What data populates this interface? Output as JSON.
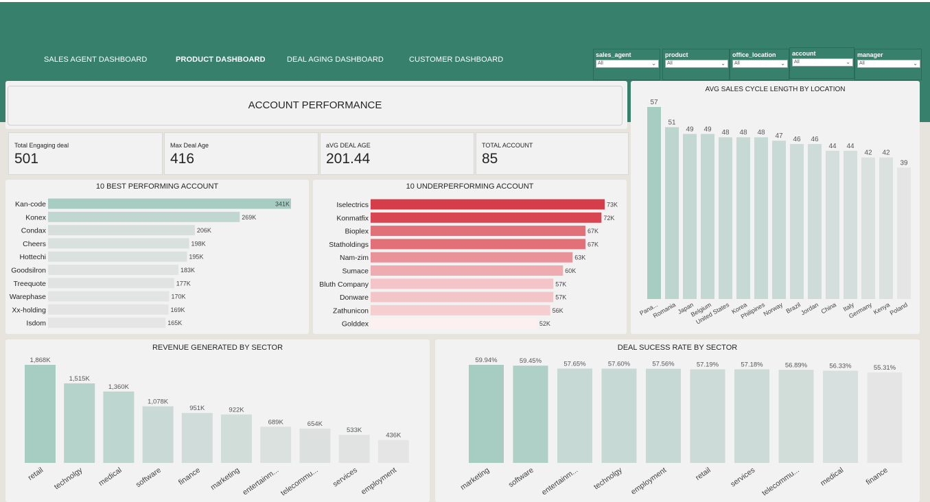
{
  "nav": [
    {
      "label": "SALES AGENT DASHBOARD",
      "active": false
    },
    {
      "label": "PRODUCT DASHBOARD",
      "active": true
    },
    {
      "label": "DEAL AGING DASHBOARD",
      "active": false
    },
    {
      "label": "CUSTOMER DASHBOARD",
      "active": false
    }
  ],
  "filters": [
    {
      "label": "sales_agent",
      "value": "All"
    },
    {
      "label": "product",
      "value": "All"
    },
    {
      "label": "office_location",
      "value": "All"
    },
    {
      "label": "account",
      "value": "All"
    },
    {
      "label": "manager",
      "value": "All"
    }
  ],
  "banner": {
    "title": "ACCOUNT PERFORMANCE"
  },
  "kpis": [
    {
      "label": "Total Engaging deal",
      "value": "501"
    },
    {
      "label": "Max Deal Age",
      "value": "416"
    },
    {
      "label": "aVG DEAL AGE",
      "value": "201.44"
    },
    {
      "label": "TOTAL ACCOUNT",
      "value": "85"
    }
  ],
  "colors": {
    "header": "#37806c",
    "panel": "#f2f2f2",
    "background": "#e6e4dc",
    "teal_strong": "#a7cdc3",
    "grey_light": "#e5e5e5",
    "red_strong": "#d63d4a",
    "red_light": "#fdf0f0"
  },
  "chart_data": [
    {
      "id": "best",
      "type": "bar",
      "orientation": "horizontal",
      "title": "10 BEST PERFORMING ACCOUNT",
      "categories": [
        "Kan-code",
        "Konex",
        "Condax",
        "Cheers",
        "Hottechi",
        "Goodsilron",
        "Treequote",
        "Warephase",
        "Xx-holding",
        "Isdom"
      ],
      "values": [
        341,
        269,
        206,
        198,
        195,
        183,
        177,
        170,
        169,
        165
      ],
      "labels": [
        "341K",
        "269K",
        "206K",
        "198K",
        "195K",
        "183K",
        "177K",
        "170K",
        "169K",
        "165K"
      ],
      "xlim": [
        0,
        341
      ]
    },
    {
      "id": "under",
      "type": "bar",
      "orientation": "horizontal",
      "title": "10 UNDERPERFORMING ACCOUNT",
      "categories": [
        "Iselectrics",
        "Konmatfix",
        "Bioplex",
        "Statholdings",
        "Nam-zim",
        "Sumace",
        "Bluth Company",
        "Donware",
        "Zathunicon",
        "Golddex"
      ],
      "values": [
        73,
        72,
        67,
        67,
        63,
        60,
        57,
        57,
        56,
        52
      ],
      "labels": [
        "73K",
        "72K",
        "67K",
        "67K",
        "63K",
        "60K",
        "57K",
        "57K",
        "56K",
        "52K"
      ],
      "xlim": [
        0,
        73
      ]
    },
    {
      "id": "cycle",
      "type": "bar",
      "title": "AVG SALES CYCLE LENGTH BY LOCATION",
      "categories": [
        "Pana...",
        "Romania",
        "Japan",
        "Belgium",
        "United States",
        "Korea",
        "Philipines",
        "Norway",
        "Brazil",
        "Jordan",
        "China",
        "Italy",
        "Germany",
        "Kenya",
        "Poland"
      ],
      "values": [
        57,
        51,
        49,
        49,
        48,
        48,
        48,
        47,
        46,
        46,
        44,
        44,
        42,
        42,
        39
      ],
      "labels": [
        "57",
        "51",
        "49",
        "49",
        "48",
        "48",
        "48",
        "47",
        "46",
        "46",
        "44",
        "44",
        "42",
        "42",
        "39"
      ],
      "ylim": [
        0,
        57
      ]
    },
    {
      "id": "revenue",
      "type": "bar",
      "title": "REVENUE GENERATED BY SECTOR",
      "categories": [
        "retail",
        "technolgy",
        "medical",
        "software",
        "finance",
        "marketing",
        "entertainm...",
        "telecommu...",
        "services",
        "employment"
      ],
      "values": [
        1868,
        1515,
        1360,
        1078,
        951,
        922,
        689,
        654,
        533,
        436
      ],
      "labels": [
        "1,868K",
        "1,515K",
        "1,360K",
        "1,078K",
        "951K",
        "922K",
        "689K",
        "654K",
        "533K",
        "436K"
      ],
      "ylim": [
        0,
        1868
      ]
    },
    {
      "id": "success",
      "type": "bar",
      "title": "DEAL SUCESS RATE BY SECTOR",
      "categories": [
        "marketing",
        "software",
        "entertainm...",
        "technolgy",
        "employment",
        "retail",
        "services",
        "telecommu...",
        "medical",
        "finance"
      ],
      "values": [
        59.94,
        59.45,
        57.65,
        57.6,
        57.56,
        57.19,
        57.18,
        56.89,
        56.33,
        55.31
      ],
      "labels": [
        "59.94%",
        "59.45%",
        "57.65%",
        "57.60%",
        "57.56%",
        "57.19%",
        "57.18%",
        "56.89%",
        "56.33%",
        "55.31%"
      ],
      "ylim": [
        0,
        59.94
      ]
    }
  ]
}
